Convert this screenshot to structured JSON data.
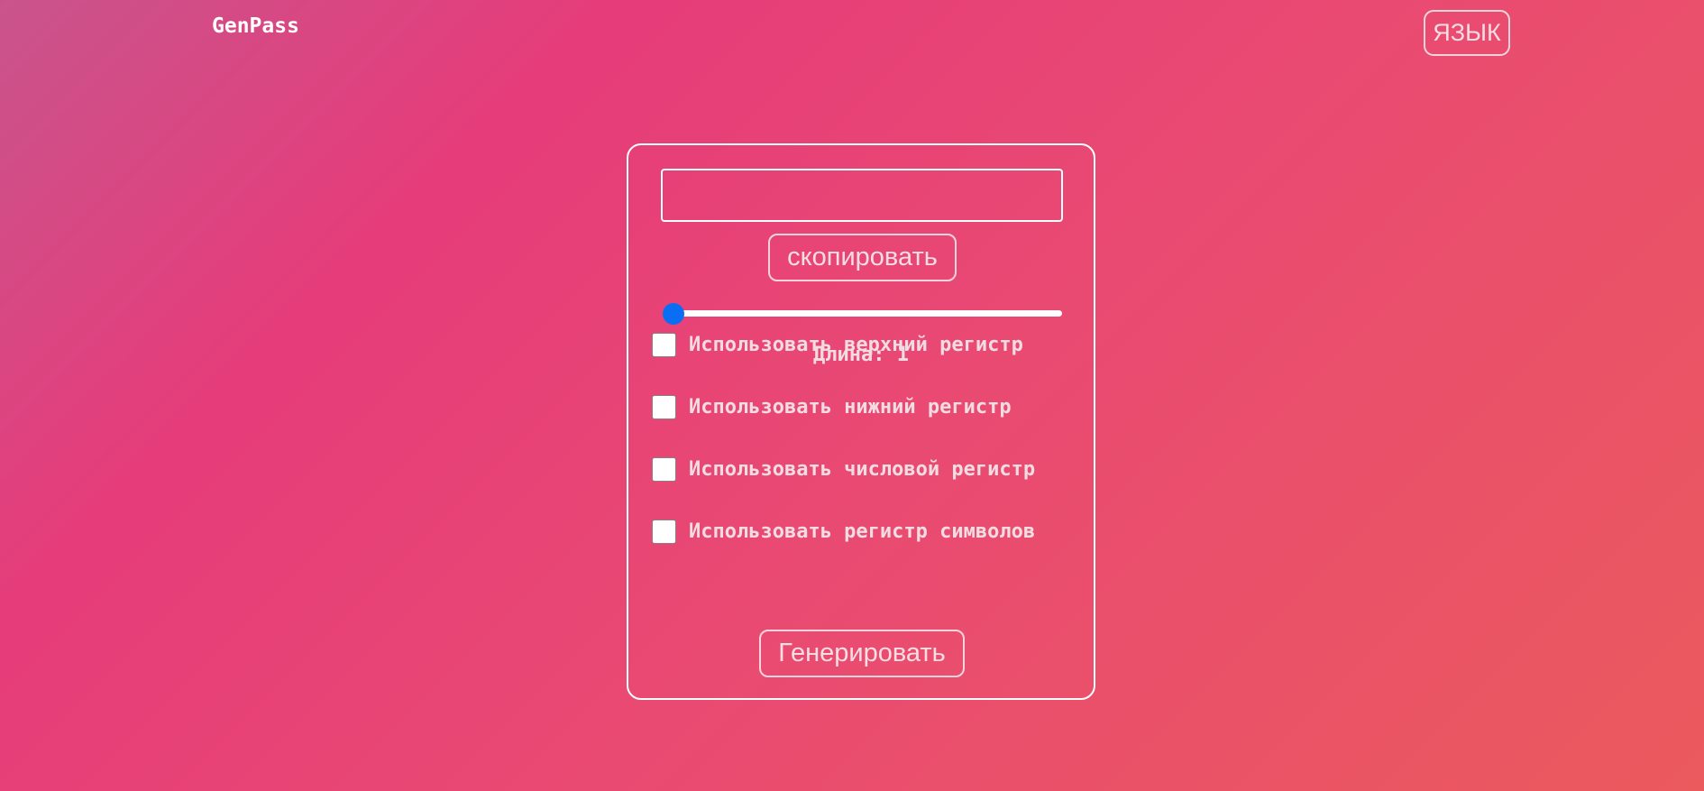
{
  "header": {
    "brand": "GenPass",
    "language_button": "ЯЗЫК"
  },
  "generator": {
    "password_value": "",
    "copy_button": "скопировать",
    "slider": {
      "min": 1,
      "max": 100,
      "value": 1
    },
    "length_label": "Длина: 1",
    "options": [
      {
        "label": "Использовать верхний регистр",
        "checked": false
      },
      {
        "label": "Использовать нижний регистр",
        "checked": false
      },
      {
        "label": "Использовать числовой регистр",
        "checked": false
      },
      {
        "label": "Использовать регистр символов",
        "checked": false
      }
    ],
    "generate_button": "Генерировать"
  },
  "colors": {
    "accent": "#0a6ef5",
    "gradient_start": "#c9548c",
    "gradient_mid": "#e63c7a",
    "gradient_end": "#eb5a5d",
    "text": "#f1dce2"
  }
}
